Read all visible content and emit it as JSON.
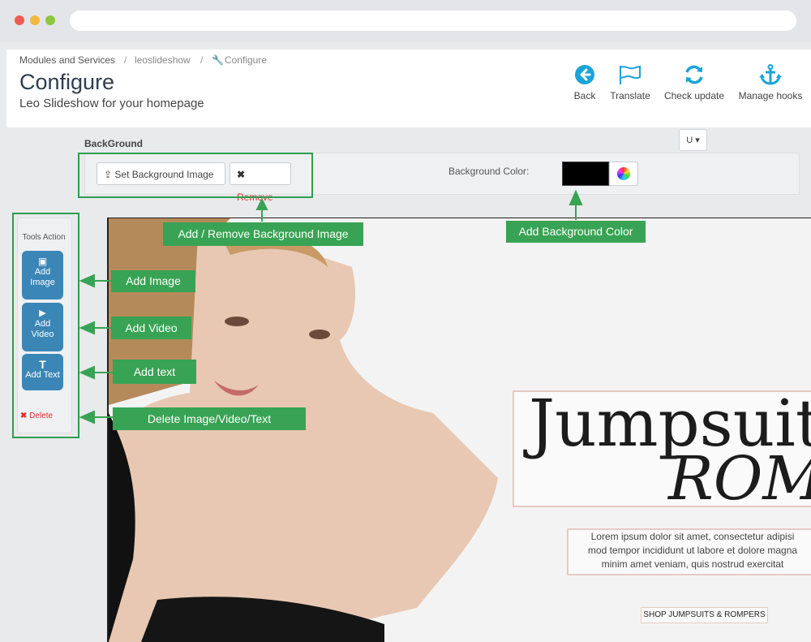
{
  "breadcrumb": {
    "items": [
      "Modules and Services",
      "leoslideshow",
      "Configure"
    ]
  },
  "page": {
    "title": "Configure",
    "subtitle": "Leo Slideshow for your homepage"
  },
  "toolbar": {
    "back": "Back",
    "translate": "Translate",
    "check_update": "Check update",
    "manage_hooks": "Manage hooks"
  },
  "background": {
    "section_label": "BackGround",
    "set_image_label": "Set Background Image",
    "remove_label": "Remove",
    "color_label": "Background Color:",
    "color_value": "#000000",
    "dropdown_label": "U"
  },
  "tools": {
    "title": "Tools Action",
    "add_image": "Add Image",
    "add_video": "Add Video",
    "add_text": "Add Text",
    "delete": "Delete"
  },
  "annotations": {
    "bg_image": "Add / Remove Background Image",
    "bg_color": "Add Background Color",
    "add_image": "Add Image",
    "add_video": "Add Video",
    "add_text": "Add text",
    "delete": "Delete Image/Video/Text"
  },
  "slide": {
    "heading_line1": "Jumpsuits",
    "heading_line2": "ROM",
    "body_line1": "Lorem ipsum dolor sit amet, consectetur adipisi",
    "body_line2": "mod tempor incididunt ut labore et dolore magna",
    "body_line3": "minim amet veniam, quis nostrud exercitat",
    "cta": "SHOP JUMPSUITS & ROMPERS"
  },
  "colors": {
    "accent": "#3a86b6",
    "annotation": "#38a354",
    "icon": "#1aa4d8",
    "danger": "#e0302a"
  }
}
